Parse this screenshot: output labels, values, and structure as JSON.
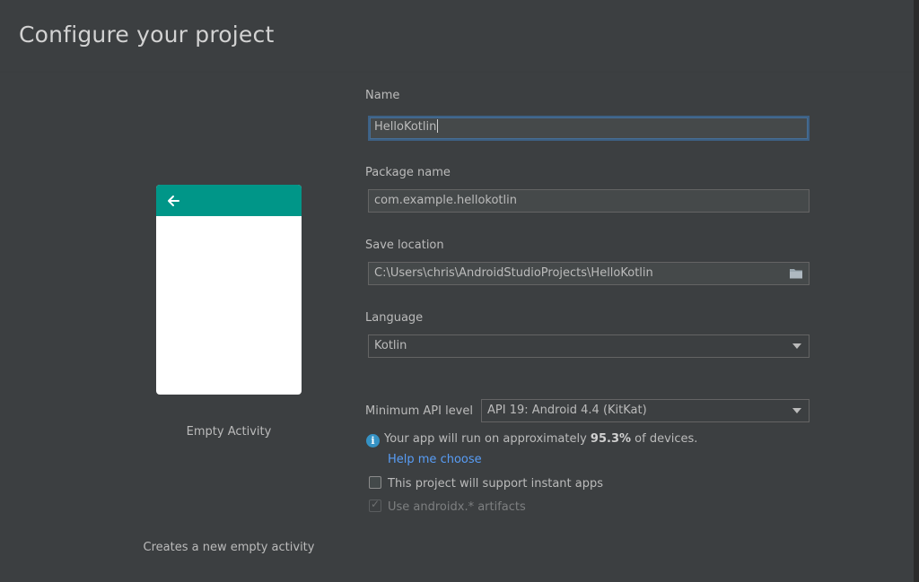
{
  "header": {
    "title": "Configure your project"
  },
  "preview": {
    "template_name": "Empty Activity",
    "description": "Creates a new empty activity",
    "toolbar_color": "#009688"
  },
  "form": {
    "name": {
      "label": "Name",
      "value": "HelloKotlin"
    },
    "package_name": {
      "label": "Package name",
      "value": "com.example.hellokotlin"
    },
    "save_location": {
      "label": "Save location",
      "value": "C:\\Users\\chris\\AndroidStudioProjects\\HelloKotlin",
      "icon": "folder-icon"
    },
    "language": {
      "label": "Language",
      "selected": "Kotlin"
    },
    "min_api": {
      "label": "Minimum API level",
      "selected": "API 19: Android 4.4 (KitKat)"
    },
    "info": {
      "prefix": "Your app will run on approximately ",
      "percent": "95.3%",
      "suffix": " of devices.",
      "help_link": "Help me choose",
      "icon_glyph": "i"
    },
    "instant_apps": {
      "label": "This project will support instant apps",
      "checked": false
    },
    "androidx": {
      "label": "Use androidx.* artifacts",
      "checked": true,
      "disabled": true
    }
  },
  "colors": {
    "background": "#3c3f41",
    "link": "#589df6",
    "focus_border": "#3d6185",
    "info_icon": "#3592c4"
  }
}
